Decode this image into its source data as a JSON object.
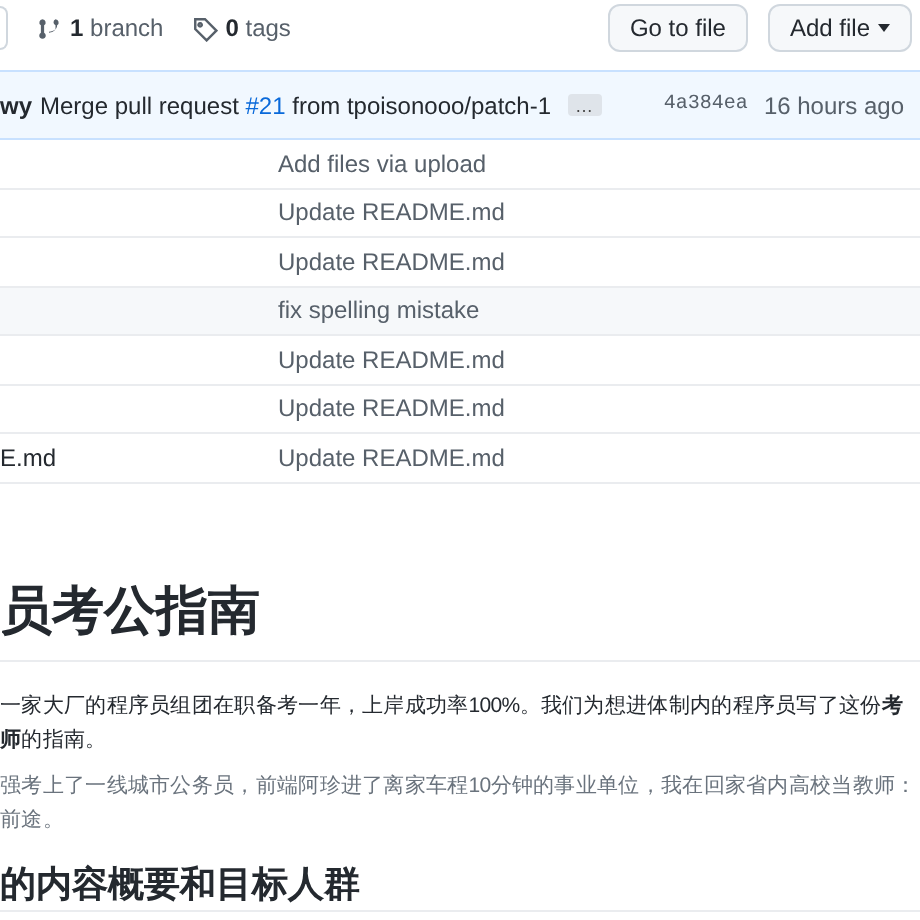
{
  "toolbar": {
    "branches": {
      "count": "1",
      "label": "branch"
    },
    "tags": {
      "count": "0",
      "label": "tags"
    },
    "buttons": [
      {
        "label": "Go to file",
        "kind": "plain"
      },
      {
        "label": "Add file",
        "kind": "dropdown"
      }
    ]
  },
  "latest_commit": {
    "author": "wy",
    "message_before": "Merge pull request",
    "pr_link": "#21",
    "message_after": "from tpoisonooo/patch-1",
    "more": "…",
    "hash": "4a384ea",
    "time": "16 hours ago"
  },
  "files": [
    {
      "message": "Add files via upload"
    },
    {
      "message": "Update README.md"
    },
    {
      "message": "Update README.md"
    },
    {
      "message": "fix spelling mistake"
    },
    {
      "message": "Update README.md"
    },
    {
      "message": "Update README.md"
    },
    {
      "name": "E.md",
      "message": "Update README.md"
    }
  ],
  "readme": [
    {
      "kind": "h1",
      "text": "员考公指南"
    },
    {
      "kind": "p",
      "lines": [
        "一家大厂的程序员组团在职备考一年，上岸成功率100%。我们为想进体制内的程序员写了这份**考**",
        "**师**的指南。"
      ]
    },
    {
      "kind": "p",
      "lines": [
        "强考上了一线城市公务员，前端阿珍进了离家车程10分钟的事业单位，我在回家省内高校当教师：",
        "前途。"
      ]
    },
    {
      "kind": "h2",
      "text": "的内容概要和目标人群"
    }
  ]
}
